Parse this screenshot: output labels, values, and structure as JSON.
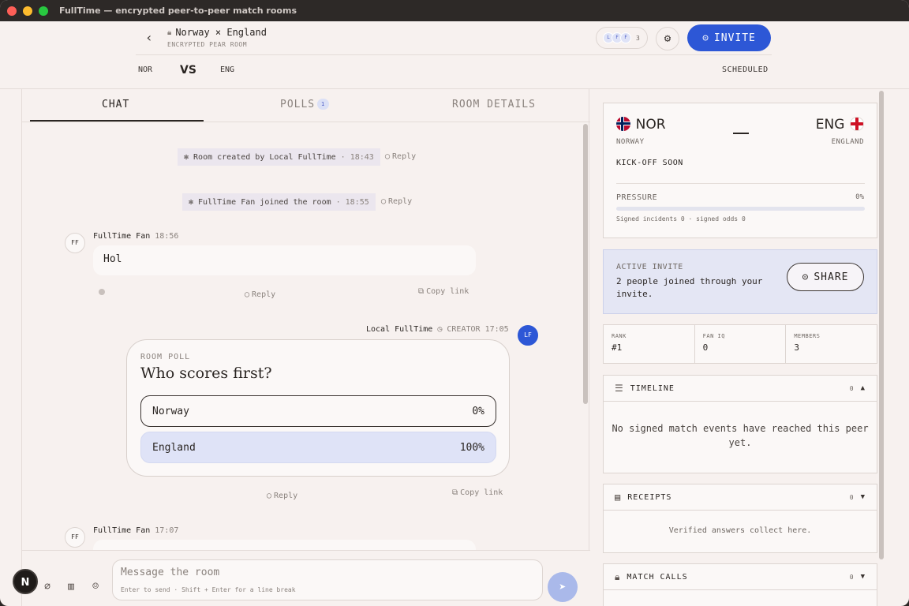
{
  "window": {
    "title": "FullTime — encrypted peer-to-peer match rooms"
  },
  "header": {
    "room_title": "Norway × England",
    "room_subtitle": "ENCRYPTED PEAR ROOM",
    "avatars": [
      "L",
      "F",
      "F"
    ],
    "avatar_count": "3",
    "invite_label": "INVITE",
    "home": "NOR",
    "vs": "VS",
    "away": "ENG",
    "status": "SCHEDULED"
  },
  "tabs": {
    "chat": "CHAT",
    "polls": "POLLS",
    "polls_badge": "1",
    "details": "ROOM DETAILS"
  },
  "chat": {
    "sys1": {
      "text": "Room created by Local FullTime",
      "time": "· 18:43"
    },
    "sys2": {
      "text": "FullTime Fan joined the room",
      "time": "· 18:55"
    },
    "reply": "Reply",
    "copy_link": "Copy link",
    "msg1": {
      "avatar": "FF",
      "author": "FullTime Fan",
      "time": "18:56",
      "text": "Hol"
    },
    "msg2": {
      "author": "Local FullTime",
      "role": "CREATOR",
      "time": "17:05",
      "avatar": "LF"
    },
    "poll": {
      "label": "ROOM POLL",
      "question": "Who scores first?",
      "options": [
        {
          "label": "Norway",
          "pct": "0%"
        },
        {
          "label": "England",
          "pct": "100%"
        }
      ]
    },
    "msg3": {
      "avatar": "FF",
      "author": "FullTime Fan",
      "time": "17:07"
    }
  },
  "composer": {
    "placeholder": "Message the room",
    "hint": "Enter to send · Shift + Enter for a line break"
  },
  "fab": {
    "label": "N"
  },
  "score": {
    "home_code": "NOR",
    "home_name": "NORWAY",
    "away_code": "ENG",
    "away_name": "ENGLAND",
    "kickoff": "KICK-OFF SOON",
    "pressure_label": "PRESSURE",
    "pressure_value": "0%",
    "signed": "Signed incidents 0 · signed odds 0"
  },
  "invite_card": {
    "label": "ACTIVE INVITE",
    "text": "2 people joined through your invite.",
    "share": "SHARE"
  },
  "stats": [
    {
      "k": "RANK",
      "v": "#1"
    },
    {
      "k": "FAN IQ",
      "v": "0"
    },
    {
      "k": "MEMBERS",
      "v": "3"
    }
  ],
  "timeline": {
    "title": "TIMELINE",
    "count": "0",
    "empty": "No signed match events have reached this peer yet."
  },
  "receipts": {
    "title": "RECEIPTS",
    "count": "0",
    "empty": "Verified answers collect here."
  },
  "calls": {
    "title": "MATCH CALLS",
    "count": "0"
  }
}
